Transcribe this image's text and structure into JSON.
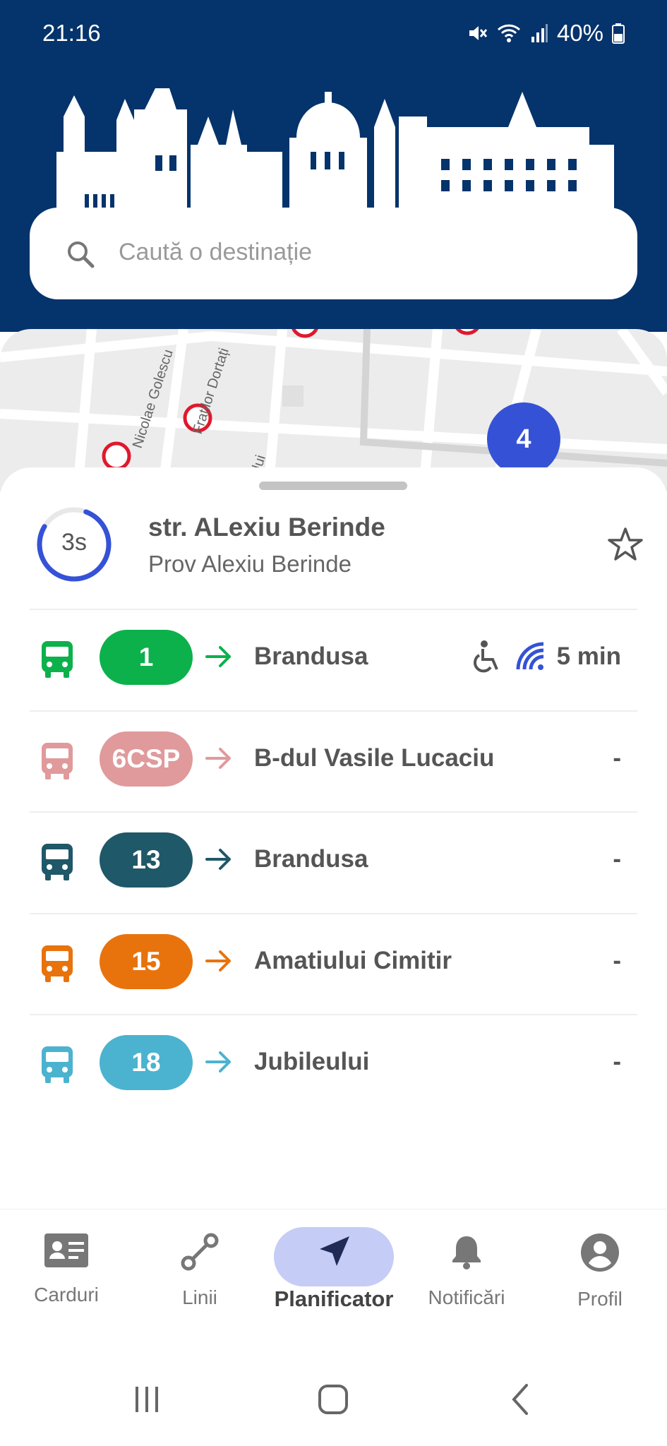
{
  "status_bar": {
    "time": "21:16",
    "battery": "40%"
  },
  "search": {
    "placeholder": "Caută o destinație"
  },
  "map": {
    "streets": [
      "Nicolae Golescu",
      "Fraților Dortați",
      "lui"
    ],
    "cluster_count": "4"
  },
  "stop": {
    "refresh_timer": "3s",
    "name": "str. ALexiu Berinde",
    "subtitle": "Prov Alexiu Berinde",
    "favorite_icon": "star-outline-icon"
  },
  "departures": [
    {
      "line": "1",
      "color": "#0cb14b",
      "destination": "Brandusa",
      "eta": "5 min",
      "accessible": true,
      "live": true
    },
    {
      "line": "6CSP",
      "color": "#e09a9c",
      "destination": "B-dul Vasile Lucaciu",
      "eta": "-",
      "accessible": false,
      "live": false
    },
    {
      "line": "13",
      "color": "#1f5868",
      "destination": "Brandusa",
      "eta": "-",
      "accessible": false,
      "live": false
    },
    {
      "line": "15",
      "color": "#e8730c",
      "destination": "Amatiului Cimitir",
      "eta": "-",
      "accessible": false,
      "live": false
    },
    {
      "line": "18",
      "color": "#4bb3cf",
      "destination": "Jubileului",
      "eta": "-",
      "accessible": false,
      "live": false
    }
  ],
  "bottom_nav": {
    "items": [
      {
        "label": "Carduri",
        "icon": "card-icon"
      },
      {
        "label": "Linii",
        "icon": "route-icon"
      },
      {
        "label": "Planificator",
        "icon": "navigation-arrow-icon",
        "active": true
      },
      {
        "label": "Notificări",
        "icon": "bell-icon"
      },
      {
        "label": "Profil",
        "icon": "profile-icon"
      }
    ]
  },
  "colors": {
    "header_bg": "#05336b",
    "accent": "#3552d6",
    "active_pill": "#c5cdf6"
  }
}
